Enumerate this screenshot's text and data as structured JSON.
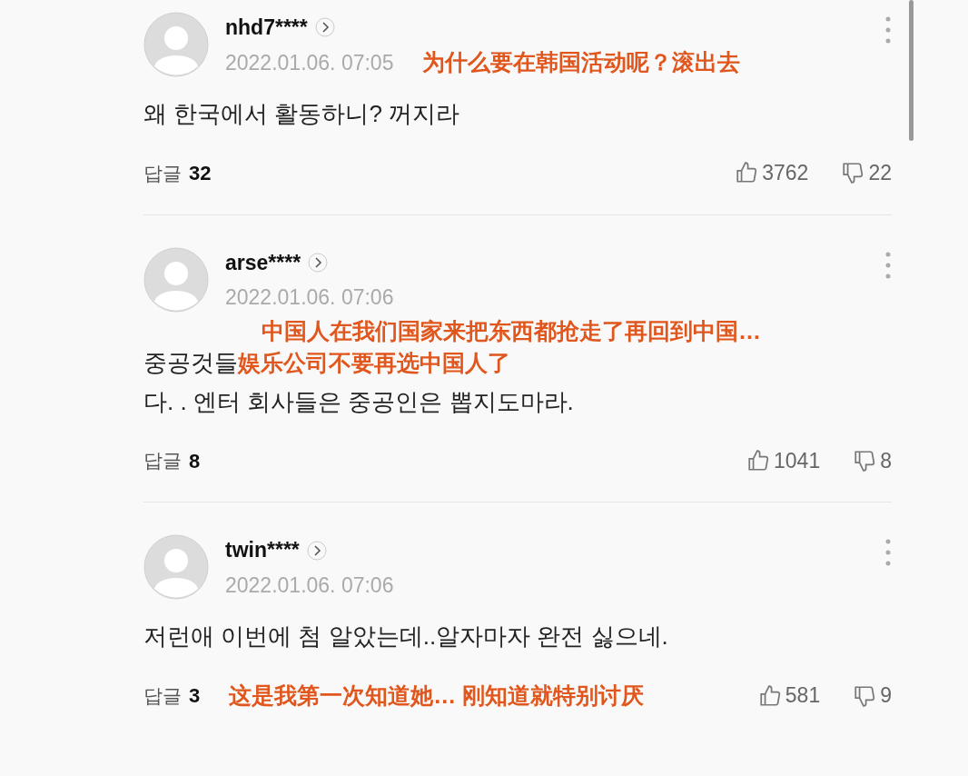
{
  "comments": [
    {
      "username": "nhd7****",
      "date": "2022.01.06. 07:05",
      "body": [
        "왜 한국에서 활동하니? 꺼지라"
      ],
      "reply_label": "답글",
      "replies": "32",
      "likes": "3762",
      "dislikes": "22",
      "annotation": {
        "kind": "date",
        "lines": [
          "为什么要在韩国活动呢？滚出去"
        ]
      }
    },
    {
      "username": "arse****",
      "date": "2022.01.06. 07:06",
      "body": [
        "중공것들",
        "다. . 엔터 회사들은 중공인은 뽑지도마라."
      ],
      "reply_label": "답글",
      "replies": "8",
      "likes": "1041",
      "dislikes": "8",
      "annotation": {
        "kind": "body",
        "lines": [
          "中国人在我们国家来把东西都抢走了再回到中国…",
          "娱乐公司不要再选中国人了"
        ]
      }
    },
    {
      "username": "twin****",
      "date": "2022.01.06. 07:06",
      "body": [
        "저런애 이번에 첨 알았는데..알자마자 완전 싫으네."
      ],
      "reply_label": "답글",
      "replies": "3",
      "likes": "581",
      "dislikes": "9",
      "annotation": {
        "kind": "footer",
        "lines": [
          "这是我第一次知道她… 刚知道就特别讨厌"
        ]
      }
    }
  ]
}
